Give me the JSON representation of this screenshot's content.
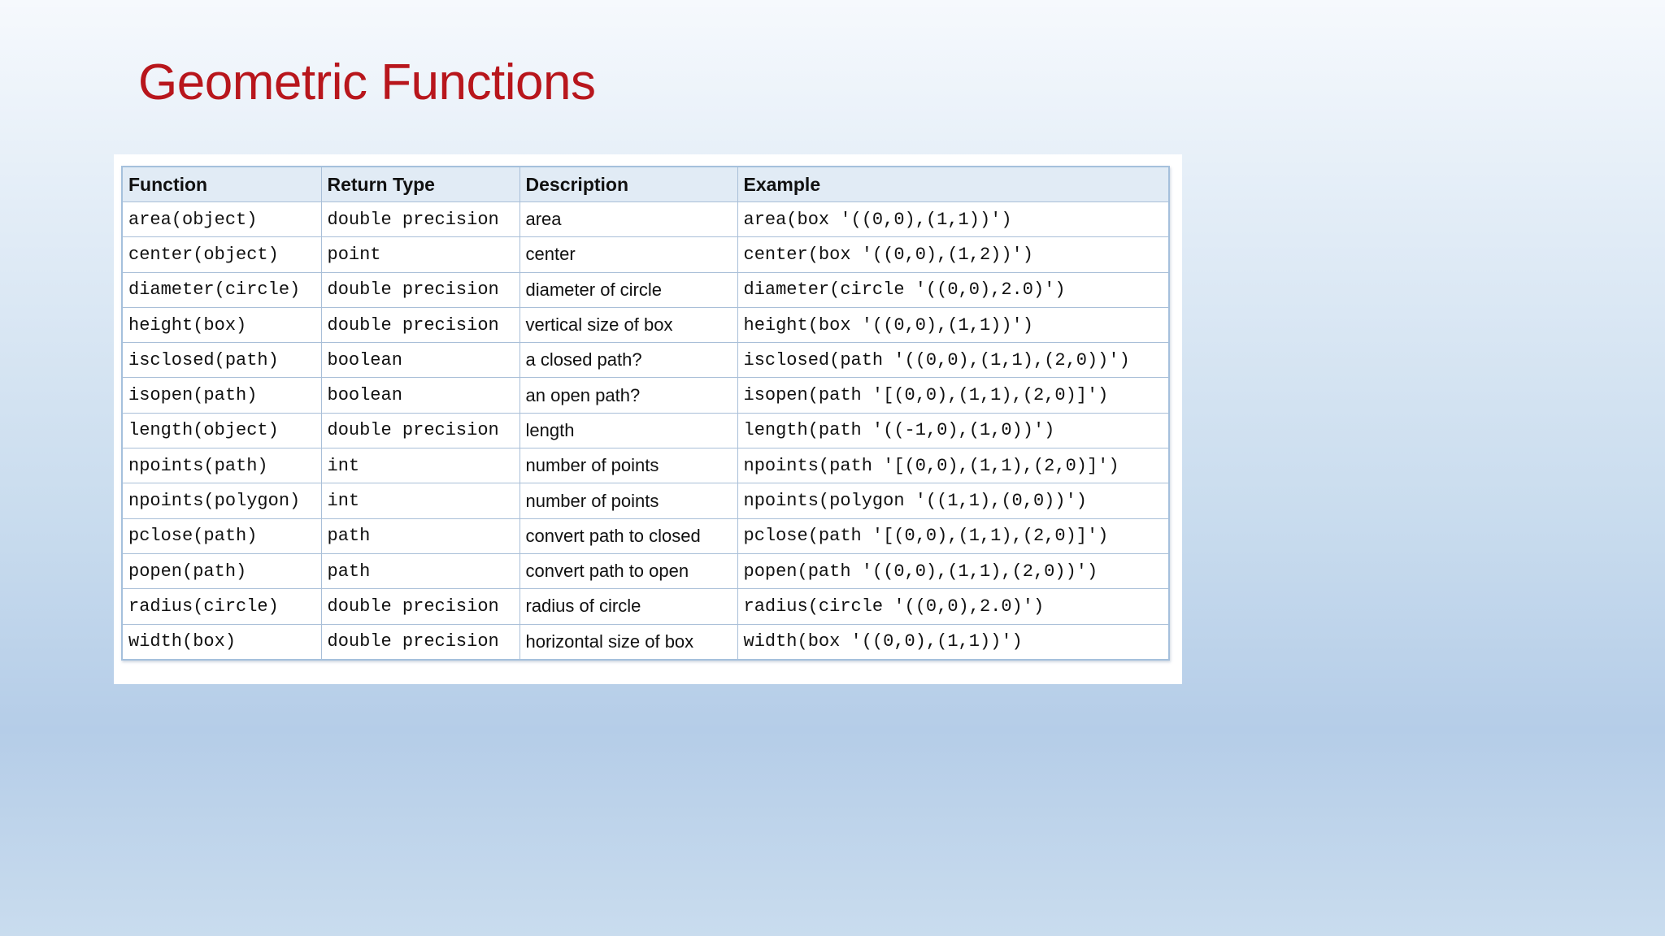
{
  "slide": {
    "title": "Geometric Functions"
  },
  "table": {
    "headers": [
      "Function",
      "Return Type",
      "Description",
      "Example"
    ],
    "rows": [
      {
        "function": "area(object)",
        "return_type": "double precision",
        "description": "area",
        "example": "area(box '((0,0),(1,1))')"
      },
      {
        "function": "center(object)",
        "return_type": "point",
        "description": "center",
        "example": "center(box '((0,0),(1,2))')"
      },
      {
        "function": "diameter(circle)",
        "return_type": "double precision",
        "description": "diameter of circle",
        "example": "diameter(circle '((0,0),2.0)')"
      },
      {
        "function": "height(box)",
        "return_type": "double precision",
        "description": "vertical size of box",
        "example": "height(box '((0,0),(1,1))')"
      },
      {
        "function": "isclosed(path)",
        "return_type": "boolean",
        "description": "a closed path?",
        "example": "isclosed(path '((0,0),(1,1),(2,0))')"
      },
      {
        "function": "isopen(path)",
        "return_type": "boolean",
        "description": "an open path?",
        "example": "isopen(path '[(0,0),(1,1),(2,0)]')"
      },
      {
        "function": "length(object)",
        "return_type": "double precision",
        "description": "length",
        "example": "length(path '((-1,0),(1,0))')"
      },
      {
        "function": "npoints(path)",
        "return_type": "int",
        "description": "number of points",
        "example": "npoints(path '[(0,0),(1,1),(2,0)]')"
      },
      {
        "function": "npoints(polygon)",
        "return_type": "int",
        "description": "number of points",
        "example": "npoints(polygon '((1,1),(0,0))')"
      },
      {
        "function": "pclose(path)",
        "return_type": "path",
        "description": "convert path to closed",
        "example": "pclose(path '[(0,0),(1,1),(2,0)]')"
      },
      {
        "function": "popen(path)",
        "return_type": "path",
        "description": "convert path to open",
        "example": "popen(path '((0,0),(1,1),(2,0))')"
      },
      {
        "function": "radius(circle)",
        "return_type": "double precision",
        "description": "radius of circle",
        "example": "radius(circle '((0,0),2.0)')"
      },
      {
        "function": "width(box)",
        "return_type": "double precision",
        "description": "horizontal size of box",
        "example": "width(box '((0,0),(1,1))')"
      }
    ]
  }
}
